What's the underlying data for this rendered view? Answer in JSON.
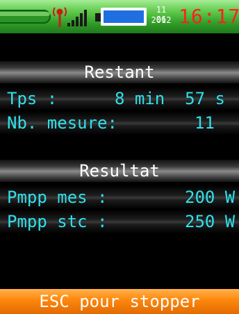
{
  "status_bar": {
    "date_day_month": "11 06",
    "date_year": "2012",
    "time": "16:17",
    "icons": [
      "battery-bar-icon",
      "antenna-icon",
      "signal-bars-icon",
      "battery-icon"
    ],
    "colors": {
      "background": "#3aaa33",
      "time": "#ff2020",
      "battery": "#1f6fe0"
    }
  },
  "restant": {
    "header": "Restant",
    "tps_label": "Tps :",
    "tps_value": "8 min  57 s",
    "nb_label": "Nb. mesure:",
    "nb_value": "11"
  },
  "resultat": {
    "header": "Resultat",
    "pmpp_mes_label": "Pmpp mes :",
    "pmpp_mes_value": "200 W",
    "pmpp_stc_label": "Pmpp stc :",
    "pmpp_stc_value": "250 W"
  },
  "footer": {
    "label": "ESC pour stopper",
    "color": "#ff8a10"
  }
}
